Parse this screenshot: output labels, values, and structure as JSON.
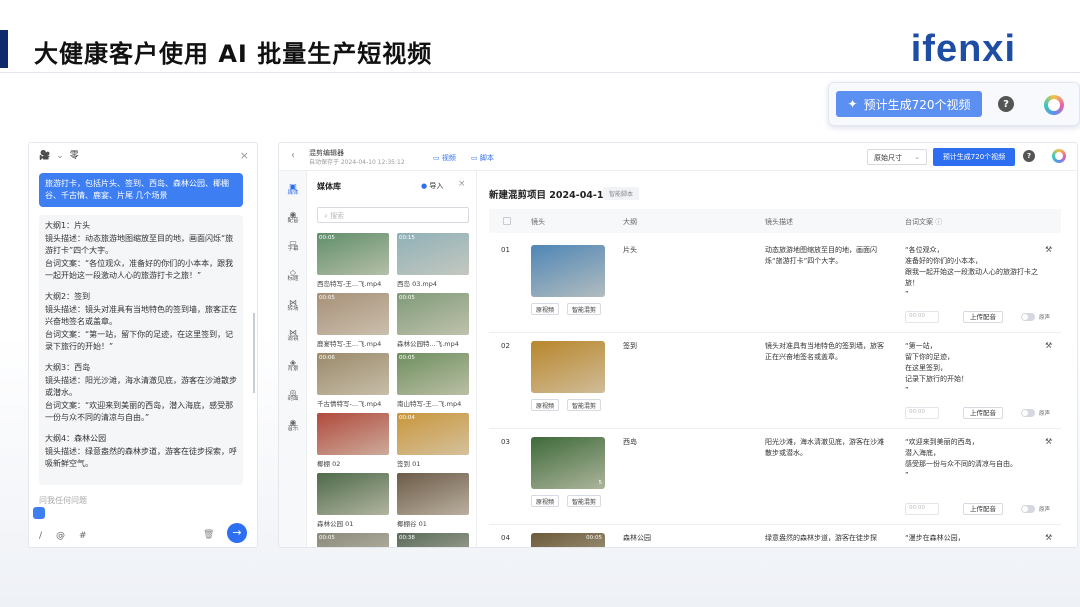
{
  "slide": {
    "title": "大健康客户使用 AI 批量生产短视频",
    "logo": "ifenxi"
  },
  "callout": {
    "button_label": "预计生成720个视频",
    "help_icon": "?"
  },
  "chat": {
    "top_icon": "camera-icon",
    "top_label": "零",
    "close": "×",
    "user_message": "旅游打卡，包括片头、签到、西岛、森林公园、椰棚谷、千古情、鹿宴、片尾 几个场景",
    "reply_lines": [
      "大纲1：片头",
      "镜头描述：动态旅游地图缩放至目的地，画面闪烁“旅游打卡”四个大字。",
      "台词文案：“各位观众，准备好的你们的小本本，跟我一起开始这一段激动人心的旅游打卡之旅！”",
      "",
      "大纲2：签到",
      "镜头描述：镜头对准具有当地特色的签到墙，旅客正在兴奋地签名或盖章。",
      "台词文案：“第一站，留下你的足迹，在这里签到，记录下旅行的开始！”",
      "",
      "大纲3：西岛",
      "镜头描述：阳光沙滩，海水清澈见底，游客在沙滩散步或潜水。",
      "台词文案：“欢迎来到美丽的西岛，潜入海底，感受那一份与众不同的清凉与自由。”",
      "",
      "大纲4：森林公园",
      "镜头描述：绿意盎然的森林步道，游客在徒步探索，呼吸新鲜空气。"
    ],
    "input_placeholder": "问我任何问题",
    "bottom_tools": [
      "/",
      "@",
      "#"
    ],
    "send": "→"
  },
  "editor": {
    "name": "混剪编辑器",
    "autosave": "自动保存于 2024-04-10 12:35:12",
    "tab_video": "视频",
    "tab_script": "脚本",
    "size_select": "原始尺寸",
    "generate_button": "预计生成720个视频",
    "help": "?",
    "sidebar": [
      "媒体",
      "配音",
      "字幕",
      "标题",
      "转场",
      "滤镜",
      "背景",
      "封面",
      "音乐"
    ],
    "media_library": {
      "title": "媒体库",
      "import": "导入",
      "close": "×",
      "search_placeholder": "搜索",
      "items": [
        {
          "name": "西岛特写-王...飞.mp4",
          "duration": "00:05",
          "color": "#5f8e6a"
        },
        {
          "name": "西岛 03.mp4",
          "duration": "00:15",
          "color": "#8fb0b8"
        },
        {
          "name": "鹿宴特写-王...飞.mp4",
          "duration": "00:05",
          "color": "#a79078"
        },
        {
          "name": "森林公园特...飞.mp4",
          "duration": "00:05",
          "color": "#7f9a78"
        },
        {
          "name": "千古情特写-...飞.mp4",
          "duration": "00:06",
          "color": "#9a8a6a"
        },
        {
          "name": "南山特写-王...飞.mp4",
          "duration": "00:05",
          "color": "#6e8f5e"
        },
        {
          "name": "椰棚 02",
          "duration": "",
          "color": "#b04a3c"
        },
        {
          "name": "签到 01",
          "duration": "00:04",
          "color": "#c9963c"
        },
        {
          "name": "森林公园 01",
          "duration": "",
          "color": "#4e6a4a"
        },
        {
          "name": "椰棚谷 01",
          "duration": "",
          "color": "#6c5a48"
        },
        {
          "name": "",
          "duration": "00:05",
          "color": "#8a8a7a"
        },
        {
          "name": "",
          "duration": "00:38",
          "color": "#5a6a5a"
        }
      ]
    },
    "project": {
      "title": "新建混剪项目 2024-04-1",
      "tag": "智能脚本",
      "columns": [
        "镜头",
        "大纲",
        "镜头描述",
        "台词文案"
      ],
      "rows": [
        {
          "num": "01",
          "outline": "片头",
          "description": "动态旅游地图缩放至目的地，画面闪烁“旅游打卡”四个大字。",
          "script": "“各位观众，\n准备好的你们的小本本，\n跟我一起开始这一段激动人心的旅游打卡之旅！\n”",
          "thumb_color": "#4f86b6",
          "duration": ""
        },
        {
          "num": "02",
          "outline": "签到",
          "description": "镜头对准具有当地特色的签到墙，旅客正在兴奋地签名或盖章。",
          "script": "“第一站，\n留下你的足迹，\n在这里签到，\n记录下旅行的开始！\n”",
          "thumb_color": "#b8862c",
          "duration": ""
        },
        {
          "num": "03",
          "outline": "西岛",
          "description": "阳光沙滩，海水清澈见底，游客在沙滩散步或潜水。",
          "script": "“欢迎来到美丽的西岛，\n潜入海底，\n感受那一份与众不同的清凉与自由。\n”",
          "thumb_color": "#3e6a3a",
          "duration": "5"
        },
        {
          "num": "04",
          "outline": "森林公园",
          "description": "绿意盎然的森林步道，游客在徒步探",
          "script": "“漫步在森林公园，",
          "thumb_color": "#6b5a3a",
          "duration": "00:05"
        }
      ],
      "btn_original": "原视频",
      "btn_smart": "智能混剪",
      "timer": "00:00",
      "upload": "上传配音",
      "mute": "原声"
    }
  }
}
